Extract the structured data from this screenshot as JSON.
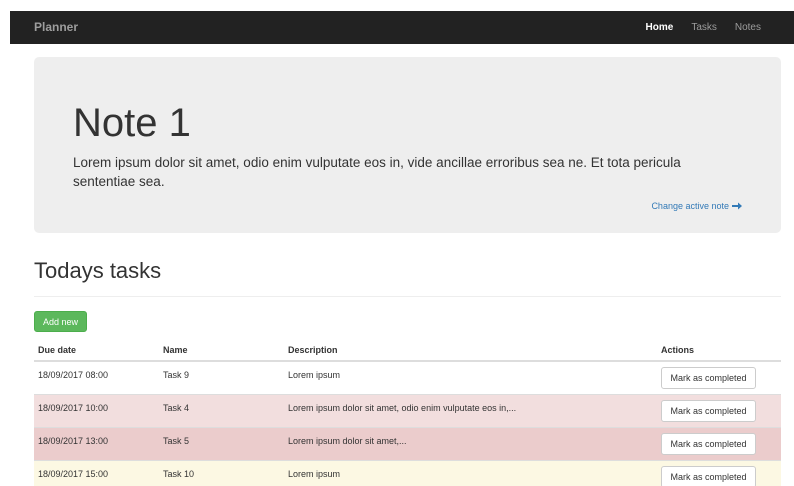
{
  "navbar": {
    "brand": "Planner",
    "links": [
      {
        "label": "Home",
        "active": true
      },
      {
        "label": "Tasks",
        "active": false
      },
      {
        "label": "Notes",
        "active": false
      }
    ]
  },
  "note": {
    "title": "Note 1",
    "body": "Lorem ipsum dolor sit amet, odio enim vulputate eos in, vide ancillae erroribus sea ne. Et tota pericula sententiae sea.",
    "change_link": "Change active note",
    "change_icon": "arrow-right-icon"
  },
  "tasks_section": {
    "title": "Todays tasks",
    "add_button": "Add new",
    "columns": [
      "Due date",
      "Name",
      "Description",
      "Actions"
    ],
    "rows": [
      {
        "due": "18/09/2017 08:00",
        "name": "Task 9",
        "description": "Lorem ipsum",
        "action": "Mark as completed"
      },
      {
        "due": "18/09/2017 10:00",
        "name": "Task 4",
        "description": "Lorem ipsum dolor sit amet, odio enim vulputate eos in,...",
        "action": "Mark as completed"
      },
      {
        "due": "18/09/2017 13:00",
        "name": "Task 5",
        "description": "Lorem ipsum dolor sit amet,...",
        "action": "Mark as completed"
      },
      {
        "due": "18/09/2017 15:00",
        "name": "Task 10",
        "description": "Lorem ipsum",
        "action": "Mark as completed"
      }
    ]
  },
  "colors": {
    "navbar_bg": "#222222",
    "link_blue": "#337ab7",
    "success_green": "#5cb85c",
    "danger_row": "#f2dede",
    "danger_row_deep": "#ebcccc",
    "warning_row": "#fcf8e3"
  }
}
